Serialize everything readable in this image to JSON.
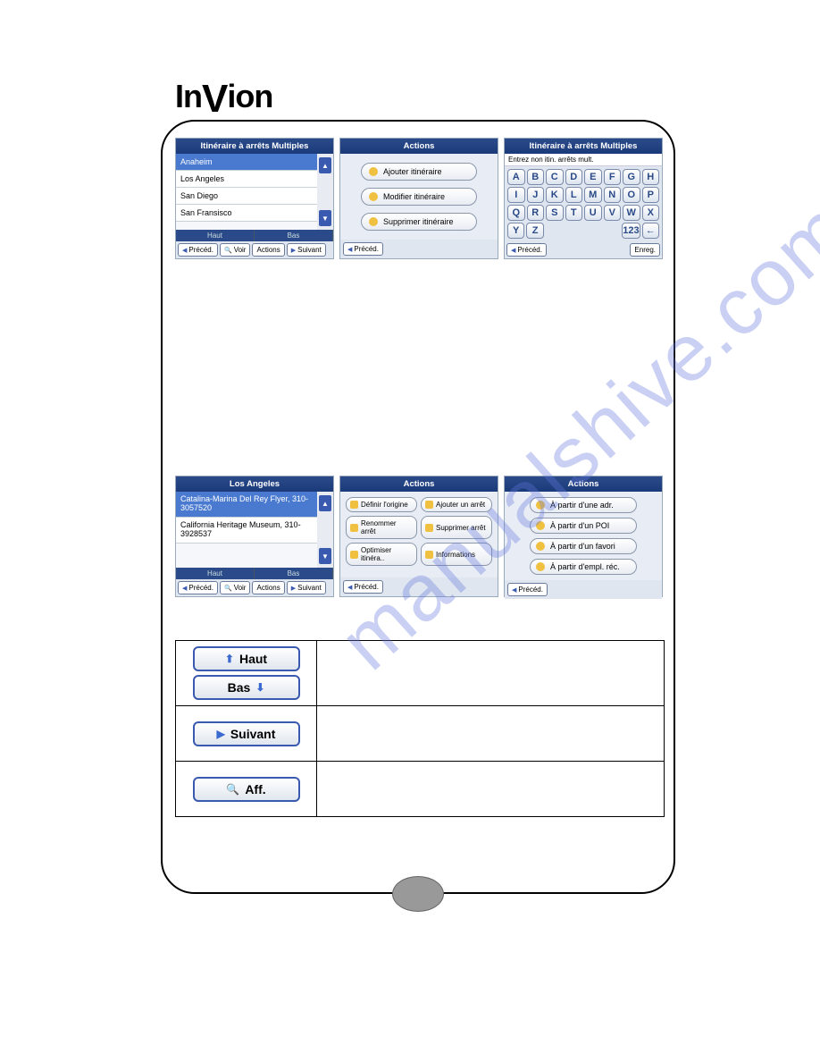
{
  "brand": "InVion",
  "watermark": "manualshive.com",
  "row1": {
    "s1": {
      "title": "Itinéraire à arrêts Multiples",
      "items": [
        "Anaheim",
        "Los Angeles",
        "San Diego",
        "San Fransisco"
      ],
      "mid": [
        "Haut",
        "Bas"
      ],
      "footer": [
        "Précéd.",
        "Voir",
        "Actions",
        "Suivant"
      ]
    },
    "s2": {
      "title": "Actions",
      "buttons": [
        "Ajouter itinéraire",
        "Modifier itinéraire",
        "Supprimer itinéraire"
      ],
      "footer": [
        "Précéd."
      ]
    },
    "s3": {
      "title": "Itinéraire à arrêts Multiples",
      "hint": "Entrez non itin. arrêts mult.",
      "keys": [
        [
          "A",
          "B",
          "C",
          "D",
          "E",
          "F",
          "G",
          "H"
        ],
        [
          "I",
          "J",
          "K",
          "L",
          "M",
          "N",
          "O",
          "P"
        ],
        [
          "Q",
          "R",
          "S",
          "T",
          "U",
          "V",
          "W",
          "X"
        ],
        [
          "Y",
          "Z",
          "",
          "",
          "",
          "",
          "123",
          "←"
        ]
      ],
      "footer_left": "Précéd.",
      "footer_right": "Enreg."
    }
  },
  "row2": {
    "s1": {
      "title": "Los Angeles",
      "items": [
        "Catalina-Marina Del Rey Flyer, 310-3057520",
        "California Heritage Museum, 310-3928537"
      ],
      "mid": [
        "Haut",
        "Bas"
      ],
      "footer": [
        "Précéd.",
        "Voir",
        "Actions",
        "Suivant"
      ]
    },
    "s2": {
      "title": "Actions",
      "buttons": [
        "Définir l'origine",
        "Ajouter un arrêt",
        "Renommer arrêt",
        "Supprimer arrêt",
        "Optimiser itinéra..",
        "Informations"
      ],
      "footer": [
        "Précéd."
      ]
    },
    "s3": {
      "title": "Actions",
      "buttons": [
        "À partir d'une adr.",
        "À partir d'un POI",
        "À partir d'un favori",
        "À partir d'empl. réc."
      ],
      "footer": [
        "Précéd."
      ]
    }
  },
  "table": {
    "r1a": "Haut",
    "r1b": "Bas",
    "r2": "Suivant",
    "r3": "Aff."
  }
}
